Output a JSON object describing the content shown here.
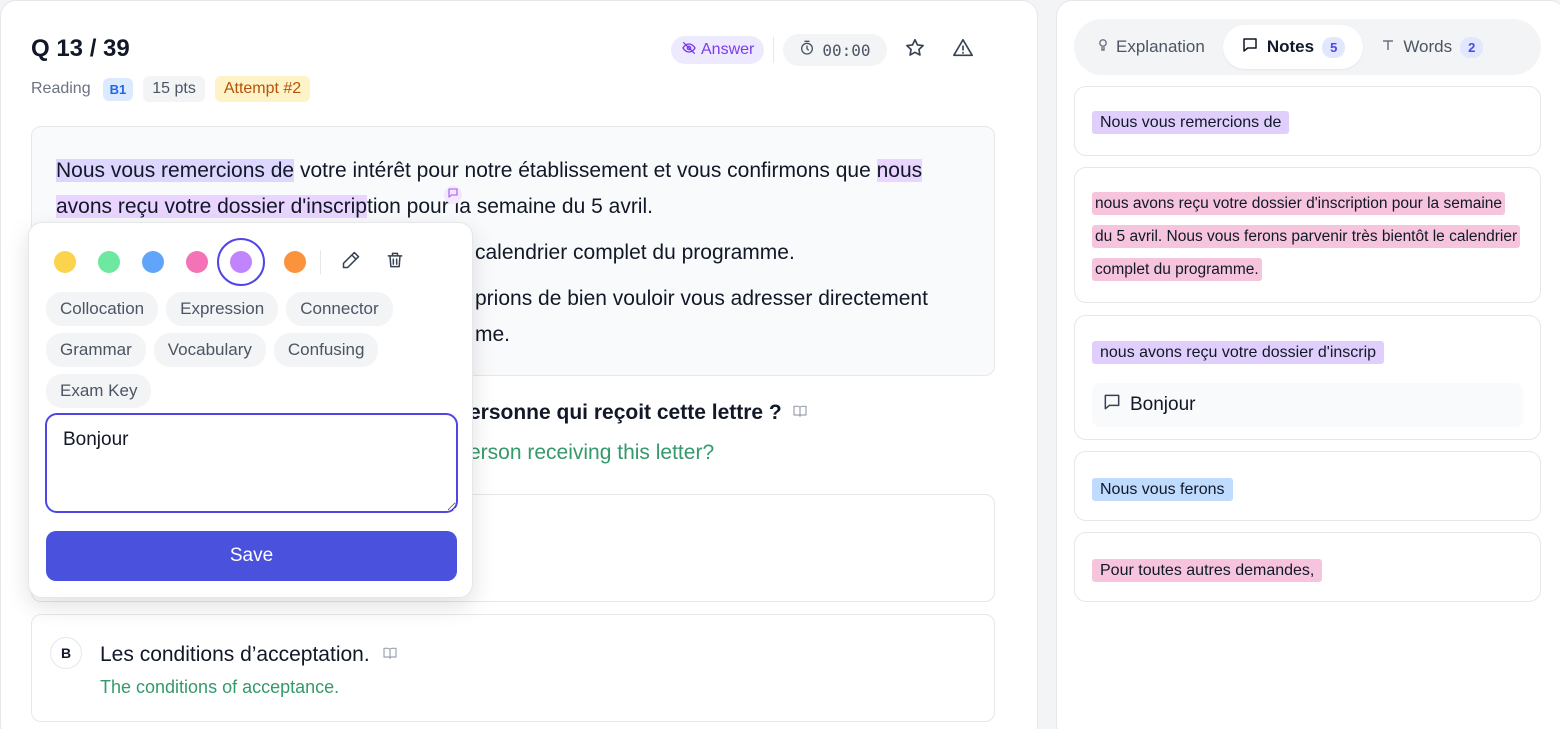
{
  "question": {
    "number_label": "Q 13 / 39",
    "category": "Reading",
    "level": "B1",
    "points": "15 pts",
    "attempt": "Attempt #2",
    "answer_label": "Answer",
    "timer": "00:00",
    "text_suffix": "ersonne qui reçoit cette lettre ?",
    "translation_suffix": "erson receiving this letter?"
  },
  "passage": {
    "p1_highlight": "Nous vous remercions de",
    "p1_rest": " votre intérêt pour notre établissement et vous confirmons que ",
    "p1_highlight2": "nous avons reçu votre dossier d'inscrip",
    "p1_end": "tion pour la semaine du 5 avril.",
    "p2": "calendrier complet du programme.",
    "p3_line1": "prions de bien vouloir vous adresser directement",
    "p3_line2": "me."
  },
  "options": [
    {
      "letter": "B",
      "text": "Les conditions d’acceptation.",
      "translation": "The conditions of acceptance."
    }
  ],
  "popover": {
    "colors": [
      "#fcd34d",
      "#6ee7a0",
      "#60a5fa",
      "#f472b6",
      "#c084fc",
      "#fb923c"
    ],
    "selected_color": "#c084fc",
    "tags": [
      "Collocation",
      "Expression",
      "Connector",
      "Grammar",
      "Vocabulary",
      "Confusing",
      "Exam Key"
    ],
    "note_value": "Bonjour",
    "save_label": "Save"
  },
  "sidebar": {
    "tabs": [
      {
        "label": "Explanation",
        "count": ""
      },
      {
        "label": "Notes",
        "count": "5"
      },
      {
        "label": "Words",
        "count": "2"
      }
    ],
    "notes": [
      {
        "text": "Nous vous remercions de",
        "color": "purple",
        "comment": ""
      },
      {
        "text": "nous avons reçu votre dossier d'inscription pour la semaine du 5 avril. Nous vous ferons parvenir très bientôt le calendrier complet du programme.",
        "color": "pink",
        "comment": ""
      },
      {
        "text": "nous avons reçu votre dossier d'inscrip",
        "color": "purple",
        "comment": "Bonjour"
      },
      {
        "text": "Nous vous ferons",
        "color": "blue",
        "comment": ""
      },
      {
        "text": "Pour toutes autres demandes,",
        "color": "pink",
        "comment": ""
      }
    ]
  }
}
